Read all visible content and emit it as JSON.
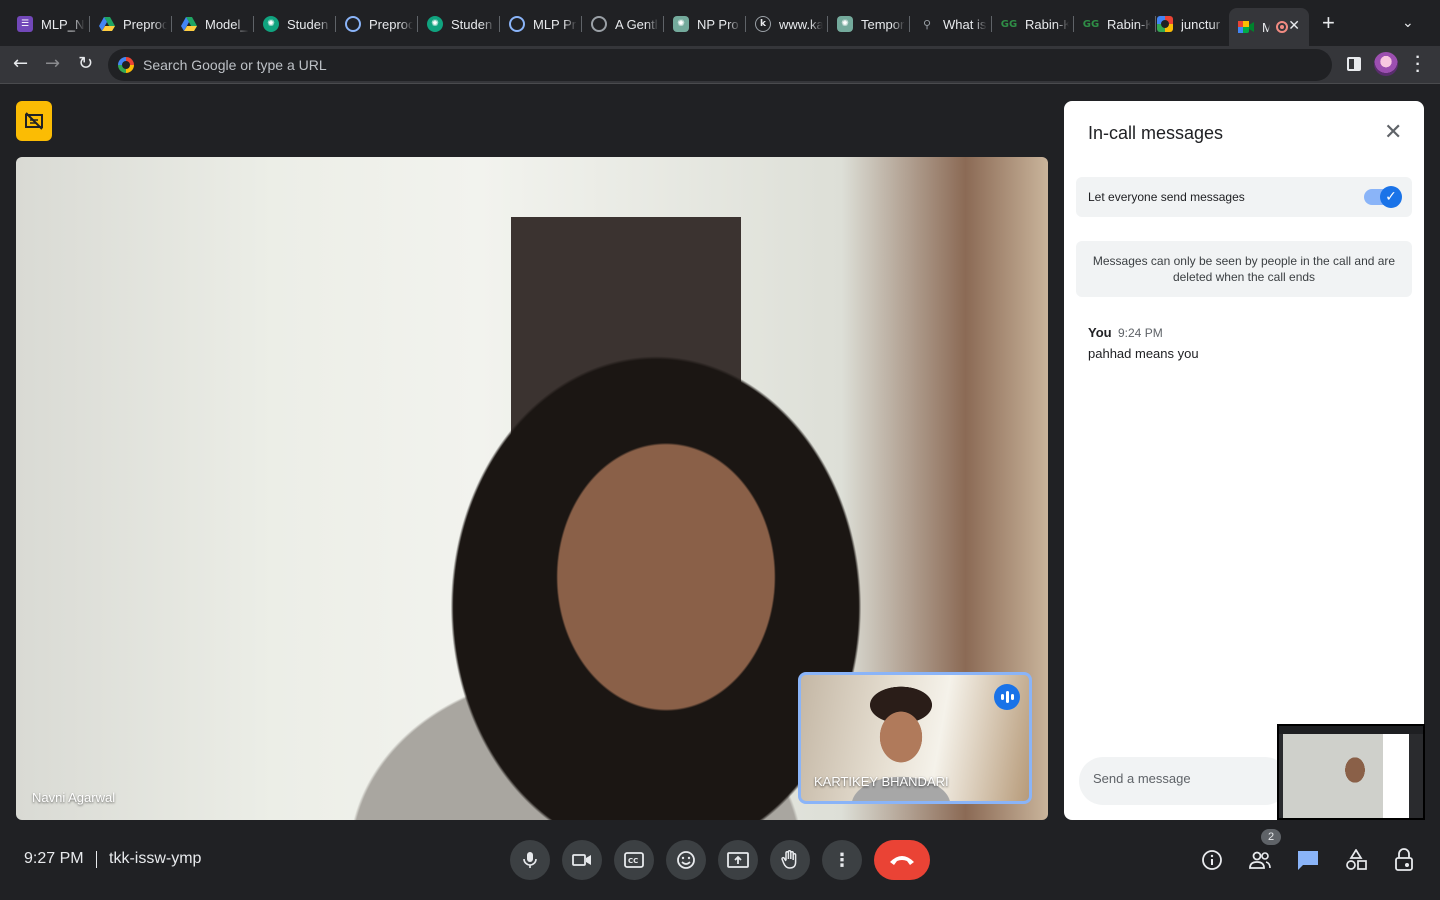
{
  "browser": {
    "tabs": [
      {
        "title": "MLP_N",
        "icon": "forms-icon",
        "color": "#7248b9"
      },
      {
        "title": "Preproc",
        "icon": "drive-icon",
        "color": "#1fa463"
      },
      {
        "title": "Model_",
        "icon": "drive-icon",
        "color": "#1fa463"
      },
      {
        "title": "Studen",
        "icon": "openai-icon",
        "color": "#10a37f"
      },
      {
        "title": "Preproc",
        "icon": "gear-site-icon",
        "color": "#8ab4f8"
      },
      {
        "title": "Studen",
        "icon": "openai-icon",
        "color": "#10a37f"
      },
      {
        "title": "MLP Pr",
        "icon": "gear-site-icon",
        "color": "#8ab4f8"
      },
      {
        "title": "A Gentl",
        "icon": "gear-site-icon",
        "color": "#9aa0a6"
      },
      {
        "title": "NP Pro",
        "icon": "openai-icon",
        "color": "#74aa9c"
      },
      {
        "title": "www.ka",
        "icon": "k-icon",
        "color": "#5f6368"
      },
      {
        "title": "Tempor",
        "icon": "openai-icon",
        "color": "#74aa9c"
      },
      {
        "title": "What is",
        "icon": "bike-icon",
        "color": "#9aa0a6"
      },
      {
        "title": "Rabin-K",
        "icon": "gfg-icon",
        "color": "#2f8d46"
      },
      {
        "title": "Rabin-K",
        "icon": "gfg-icon",
        "color": "#2f8d46"
      },
      {
        "title": "junctur",
        "icon": "google-icon",
        "color": "#4285f4"
      },
      {
        "title": "M",
        "icon": "meet-icon",
        "color": "#00832d",
        "active": true
      }
    ],
    "omnibox_placeholder": "Search Google or type a URL"
  },
  "meet": {
    "main_participant": "Navni Agarwal",
    "pip_participant": "KARTIKEY BHANDARI",
    "time": "9:27 PM",
    "meeting_code": "tkk-issw-ymp",
    "people_count": "2"
  },
  "chat": {
    "title": "In-call messages",
    "setting_label": "Let everyone send messages",
    "setting_enabled": true,
    "info": "Messages can only be seen by people in the call and are deleted when the call ends",
    "messages": [
      {
        "sender": "You",
        "time": "9:24 PM",
        "text": "pahhad means you"
      }
    ],
    "input_placeholder": "Send a message"
  },
  "colors": {
    "accent": "#1a73e8",
    "hangup": "#ea4335",
    "notice": "#fbbc04",
    "background": "#202124"
  }
}
